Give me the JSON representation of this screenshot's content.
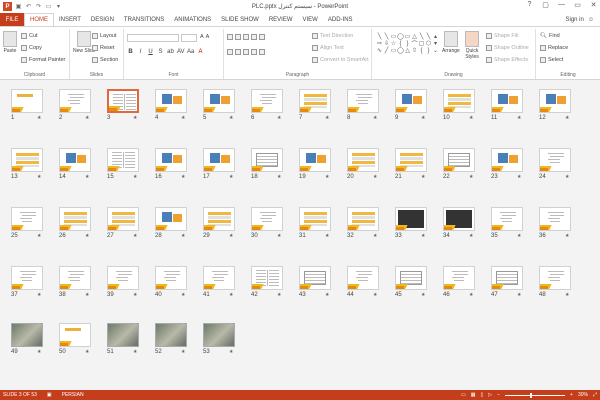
{
  "window": {
    "title": "PLC.pptx سیستم کنترل - PowerPoint",
    "controls": [
      "?",
      "▢",
      "—",
      "▭",
      "✕"
    ]
  },
  "tabs": {
    "file": "FILE",
    "items": [
      "HOME",
      "INSERT",
      "DESIGN",
      "TRANSITIONS",
      "ANIMATIONS",
      "SLIDE SHOW",
      "REVIEW",
      "VIEW",
      "ADD-INS"
    ],
    "active": "HOME",
    "signin": "Sign in"
  },
  "ribbon": {
    "clipboard": {
      "label": "Clipboard",
      "paste": "Paste",
      "cut": "Cut",
      "copy": "Copy",
      "format_painter": "Format Painter"
    },
    "slides": {
      "label": "Slides",
      "new_slide": "New Slide",
      "layout": "Layout",
      "reset": "Reset",
      "section": "Section"
    },
    "font": {
      "label": "Font",
      "buttons": [
        "B",
        "I",
        "U",
        "S",
        "ab",
        "AV",
        "Aa",
        "A"
      ]
    },
    "paragraph": {
      "label": "Paragraph",
      "text_direction": "Text Direction",
      "align_text": "Align Text",
      "convert_smartart": "Convert to SmartArt"
    },
    "drawing": {
      "label": "Drawing",
      "arrange": "Arrange",
      "quick_styles": "Quick Styles",
      "shape_fill": "Shape Fill",
      "shape_outline": "Shape Outline",
      "shape_effects": "Shape Effects"
    },
    "editing": {
      "label": "Editing",
      "find": "Find",
      "replace": "Replace",
      "select": "Select"
    }
  },
  "slides": [
    {
      "num": "1",
      "style": "title"
    },
    {
      "num": "2",
      "style": "text"
    },
    {
      "num": "3",
      "style": "textlines",
      "selected": true
    },
    {
      "num": "4",
      "style": "pic"
    },
    {
      "num": "5",
      "style": "pic"
    },
    {
      "num": "6",
      "style": "text"
    },
    {
      "num": "7",
      "style": "table"
    },
    {
      "num": "8",
      "style": "text"
    },
    {
      "num": "9",
      "style": "pic"
    },
    {
      "num": "10",
      "style": "table"
    },
    {
      "num": "11",
      "style": "pic"
    },
    {
      "num": "12",
      "style": "pic"
    },
    {
      "num": "13",
      "style": "table"
    },
    {
      "num": "14",
      "style": "pic"
    },
    {
      "num": "15",
      "style": "textlines"
    },
    {
      "num": "16",
      "style": "pic"
    },
    {
      "num": "17",
      "style": "pic"
    },
    {
      "num": "18",
      "style": "grid"
    },
    {
      "num": "19",
      "style": "pic"
    },
    {
      "num": "20",
      "style": "table"
    },
    {
      "num": "21",
      "style": "table"
    },
    {
      "num": "22",
      "style": "grid"
    },
    {
      "num": "23",
      "style": "pic"
    },
    {
      "num": "24",
      "style": "text"
    },
    {
      "num": "25",
      "style": "text"
    },
    {
      "num": "26",
      "style": "table"
    },
    {
      "num": "27",
      "style": "table"
    },
    {
      "num": "28",
      "style": "pic"
    },
    {
      "num": "29",
      "style": "table"
    },
    {
      "num": "30",
      "style": "text"
    },
    {
      "num": "31",
      "style": "table"
    },
    {
      "num": "32",
      "style": "table"
    },
    {
      "num": "33",
      "style": "dark"
    },
    {
      "num": "34",
      "style": "dark"
    },
    {
      "num": "35",
      "style": "text"
    },
    {
      "num": "36",
      "style": "text"
    },
    {
      "num": "37",
      "style": "text"
    },
    {
      "num": "38",
      "style": "text"
    },
    {
      "num": "39",
      "style": "text"
    },
    {
      "num": "40",
      "style": "text"
    },
    {
      "num": "41",
      "style": "text"
    },
    {
      "num": "42",
      "style": "textlines"
    },
    {
      "num": "43",
      "style": "grid"
    },
    {
      "num": "44",
      "style": "text"
    },
    {
      "num": "45",
      "style": "grid"
    },
    {
      "num": "46",
      "style": "text"
    },
    {
      "num": "47",
      "style": "grid"
    },
    {
      "num": "48",
      "style": "text"
    },
    {
      "num": "49",
      "style": "photo"
    },
    {
      "num": "50",
      "style": "title"
    },
    {
      "num": "51",
      "style": "photo"
    },
    {
      "num": "52",
      "style": "photo"
    },
    {
      "num": "53",
      "style": "photo"
    }
  ],
  "star_glyph": "★",
  "status": {
    "slide": "SLIDE 3 OF 53",
    "language": "PERSIAN",
    "zoom": "30%",
    "zoom_level": 0.3
  },
  "colors": {
    "accent": "#c43e1c",
    "wedge": "#f2b61e",
    "selected_border": "#e06a3d"
  }
}
